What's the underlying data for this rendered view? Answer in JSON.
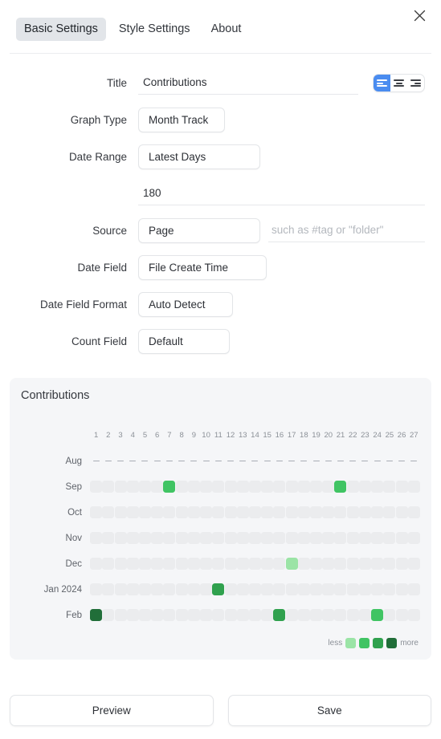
{
  "window": {
    "close_label": "×"
  },
  "tabs": [
    {
      "label": "Basic Settings",
      "active": true
    },
    {
      "label": "Style Settings",
      "active": false
    },
    {
      "label": "About",
      "active": false
    }
  ],
  "form": {
    "title": {
      "label": "Title",
      "value": "Contributions",
      "placeholder": ""
    },
    "align": {
      "options": [
        "align-left",
        "align-center",
        "align-right"
      ],
      "selected": "align-left",
      "active_color": "#4a8cf0"
    },
    "graph_type": {
      "label": "Graph Type",
      "value": "Month Track"
    },
    "date_range": {
      "label": "Date Range",
      "value": "Latest Days"
    },
    "date_range_days": {
      "value": "180",
      "placeholder": ""
    },
    "source": {
      "label": "Source",
      "value": "Page",
      "filter_value": "",
      "filter_placeholder": "such as #tag or \"folder\""
    },
    "date_field": {
      "label": "Date Field",
      "value": "File Create Time"
    },
    "date_field_format": {
      "label": "Date Field Format",
      "value": "Auto Detect"
    },
    "count_field": {
      "label": "Count Field",
      "value": "Default"
    }
  },
  "preview": {
    "title": "Contributions",
    "legend": {
      "less_label": "less",
      "more_label": "more",
      "colors": [
        "#9be4a6",
        "#40c463",
        "#30a14e",
        "#216e39"
      ]
    }
  },
  "chart_data": {
    "type": "heatmap",
    "title": "Contributions",
    "xlabel": "",
    "ylabel": "",
    "columns": [
      1,
      2,
      3,
      4,
      5,
      6,
      7,
      8,
      9,
      10,
      11,
      12,
      13,
      14,
      15,
      16,
      17,
      18,
      19,
      20,
      21,
      22,
      23,
      24,
      25,
      26,
      27
    ],
    "rows": [
      "Aug",
      "Sep",
      "Oct",
      "Nov",
      "Dec",
      "Jan 2024",
      "Feb"
    ],
    "empty_color": "#ebecee",
    "scale_colors": [
      "#ebecee",
      "#9be4a6",
      "#40c463",
      "#30a14e",
      "#216e39"
    ],
    "row_styles": [
      "dash",
      "cells",
      "cells",
      "cells",
      "cells",
      "cells",
      "cells"
    ],
    "values": [
      [
        null,
        null,
        null,
        null,
        null,
        null,
        null,
        null,
        null,
        null,
        null,
        null,
        null,
        null,
        null,
        null,
        null,
        null,
        null,
        null,
        null,
        null,
        null,
        null,
        null,
        null,
        null
      ],
      [
        0,
        0,
        0,
        0,
        0,
        0,
        2,
        0,
        0,
        0,
        0,
        0,
        0,
        0,
        0,
        0,
        0,
        0,
        0,
        0,
        2,
        0,
        0,
        0,
        0,
        0,
        0
      ],
      [
        0,
        0,
        0,
        0,
        0,
        0,
        0,
        0,
        0,
        0,
        0,
        0,
        0,
        0,
        0,
        0,
        0,
        0,
        0,
        0,
        0,
        0,
        0,
        0,
        0,
        0,
        0
      ],
      [
        0,
        0,
        0,
        0,
        0,
        0,
        0,
        0,
        0,
        0,
        0,
        0,
        0,
        0,
        0,
        0,
        0,
        0,
        0,
        0,
        0,
        0,
        0,
        0,
        0,
        0,
        0
      ],
      [
        0,
        0,
        0,
        0,
        0,
        0,
        0,
        0,
        0,
        0,
        0,
        0,
        0,
        0,
        0,
        0,
        1,
        0,
        0,
        0,
        0,
        0,
        0,
        0,
        0,
        0,
        0
      ],
      [
        0,
        0,
        0,
        0,
        0,
        0,
        0,
        0,
        0,
        0,
        3,
        0,
        0,
        0,
        0,
        0,
        0,
        0,
        0,
        0,
        0,
        0,
        0,
        0,
        0,
        0,
        0
      ],
      [
        4,
        0,
        0,
        0,
        0,
        0,
        0,
        0,
        0,
        0,
        0,
        0,
        0,
        0,
        0,
        3,
        0,
        0,
        0,
        0,
        0,
        0,
        0,
        2,
        0,
        0,
        0
      ]
    ]
  },
  "footer": {
    "preview_label": "Preview",
    "save_label": "Save"
  }
}
